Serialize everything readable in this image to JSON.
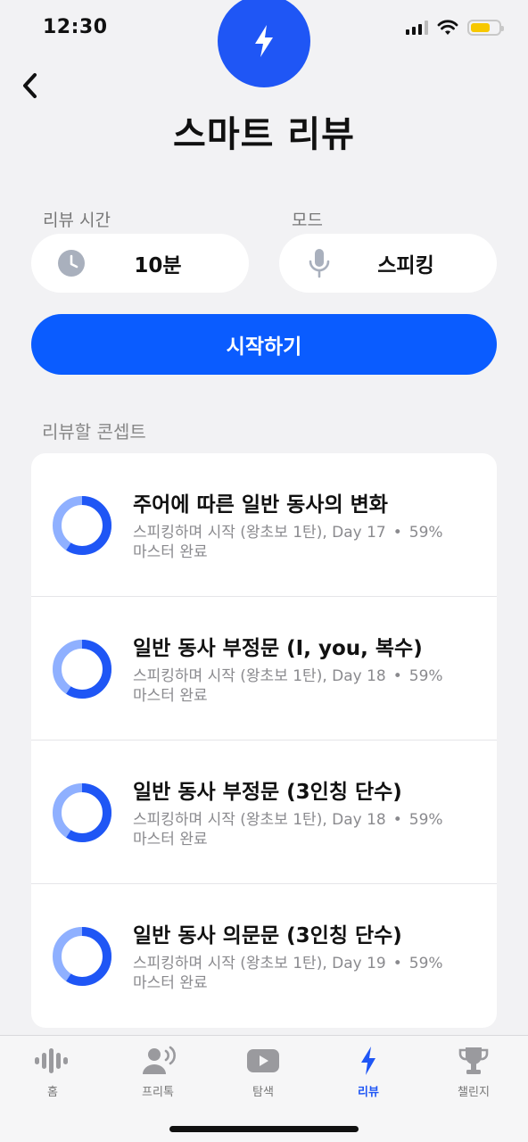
{
  "status_bar": {
    "time": "12:30"
  },
  "header": {
    "title": "스마트 리뷰"
  },
  "settings": {
    "review_time_label": "리뷰 시간",
    "review_time_value": "10분",
    "mode_label": "모드",
    "mode_value": "스피킹"
  },
  "start_button_label": "시작하기",
  "concepts_section_label": "리뷰할 콘셉트",
  "concepts": [
    {
      "title": "주어에 따른 일반 동사의 변화",
      "source": "스피킹하며 시작 (왕초보 1탄), Day 17",
      "separator": "•",
      "mastery": "59%",
      "mastery_suffix": "마스터 완료"
    },
    {
      "title": "일반 동사 부정문 (I, you, 복수)",
      "source": "스피킹하며 시작 (왕초보 1탄), Day 18",
      "separator": "•",
      "mastery": "59%",
      "mastery_suffix": "마스터 완료"
    },
    {
      "title": "일반 동사 부정문 (3인칭 단수)",
      "source": "스피킹하며 시작 (왕초보 1탄), Day 18",
      "separator": "•",
      "mastery": "59%",
      "mastery_suffix": "마스터 완료"
    },
    {
      "title": "일반 동사 의문문 (3인칭 단수)",
      "source": "스피킹하며 시작 (왕초보 1탄), Day 19",
      "separator": "•",
      "mastery": "59%",
      "mastery_suffix": "마스터 완료"
    }
  ],
  "mastery_fraction": 0.59,
  "tabs": [
    {
      "label": "홈",
      "icon": "waveform-icon"
    },
    {
      "label": "프리톡",
      "icon": "speaking-person-icon"
    },
    {
      "label": "탐색",
      "icon": "play-icon"
    },
    {
      "label": "리뷰",
      "icon": "lightning-icon",
      "active": true
    },
    {
      "label": "챌린지",
      "icon": "trophy-icon"
    }
  ],
  "colors": {
    "accent": "#1f56f5",
    "button": "#0a5cff",
    "ring_light": "#8fb0ff",
    "background": "#f2f2f4"
  }
}
